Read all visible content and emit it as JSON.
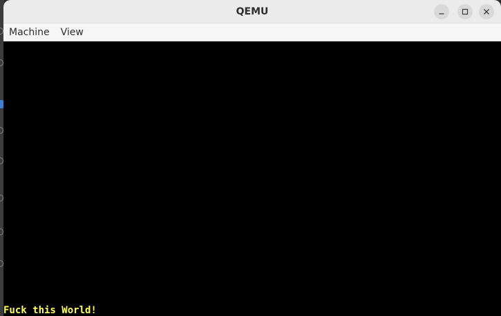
{
  "window": {
    "title": "QEMU"
  },
  "menubar": {
    "items": [
      {
        "label": "Machine"
      },
      {
        "label": "View"
      }
    ]
  },
  "screen": {
    "console_text": "Fuck this World!",
    "text_color": "#ffff55",
    "background": "#000000"
  },
  "icons": {
    "minimize": "minimize-icon",
    "maximize": "maximize-icon",
    "close": "close-icon"
  }
}
